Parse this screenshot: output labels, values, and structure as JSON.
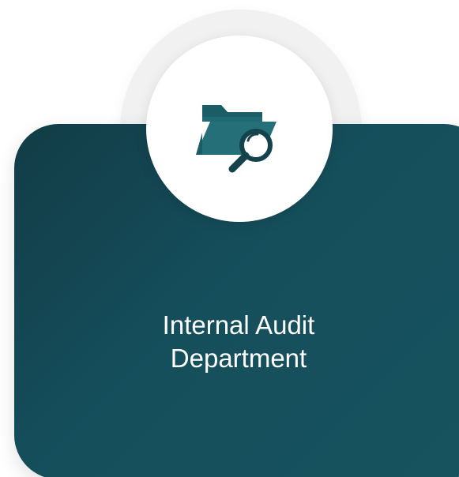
{
  "card": {
    "title_line1": "Internal Audit",
    "title_line2": "Department"
  },
  "icons": {
    "main": "folder-search-icon"
  },
  "colors": {
    "card_dark": "#123c46",
    "card_teal": "#17525f",
    "icon_teal": "#1f6a73",
    "halo": "#f1f1f1",
    "text": "#ffffff"
  }
}
